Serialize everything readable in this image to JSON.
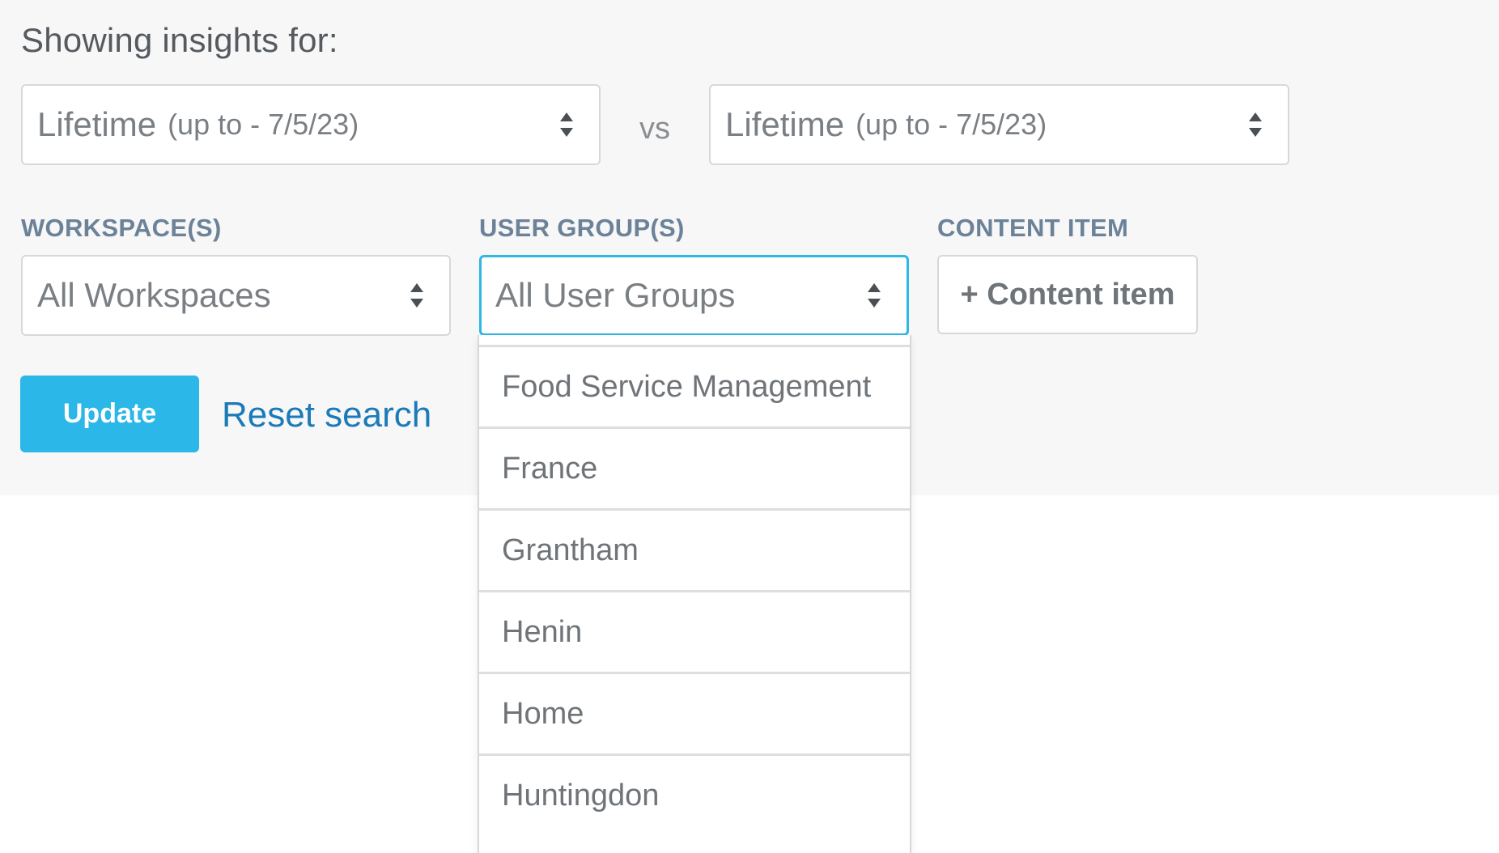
{
  "heading": "Showing insights for:",
  "period_a": {
    "main": "Lifetime",
    "sub": "(up to - 7/5/23)"
  },
  "vs_label": "vs",
  "period_b": {
    "main": "Lifetime",
    "sub": "(up to - 7/5/23)"
  },
  "workspace": {
    "label": "WORKSPACE(S)",
    "value": "All Workspaces"
  },
  "user_group": {
    "label": "USER GROUP(S)",
    "value": "All User Groups",
    "options": [
      "Food Service Management",
      "France",
      "Grantham",
      "Henin",
      "Home",
      "Huntingdon"
    ]
  },
  "content_item": {
    "label": "CONTENT ITEM",
    "button": "+ Content item"
  },
  "actions": {
    "update": "Update",
    "reset": "Reset search"
  },
  "colors": {
    "accent": "#2bb7e8",
    "link": "#1b7ab8",
    "label": "#6c8299",
    "focus": "#2fb7e5"
  },
  "icons": {
    "select_arrow": "updown-arrows-icon"
  }
}
